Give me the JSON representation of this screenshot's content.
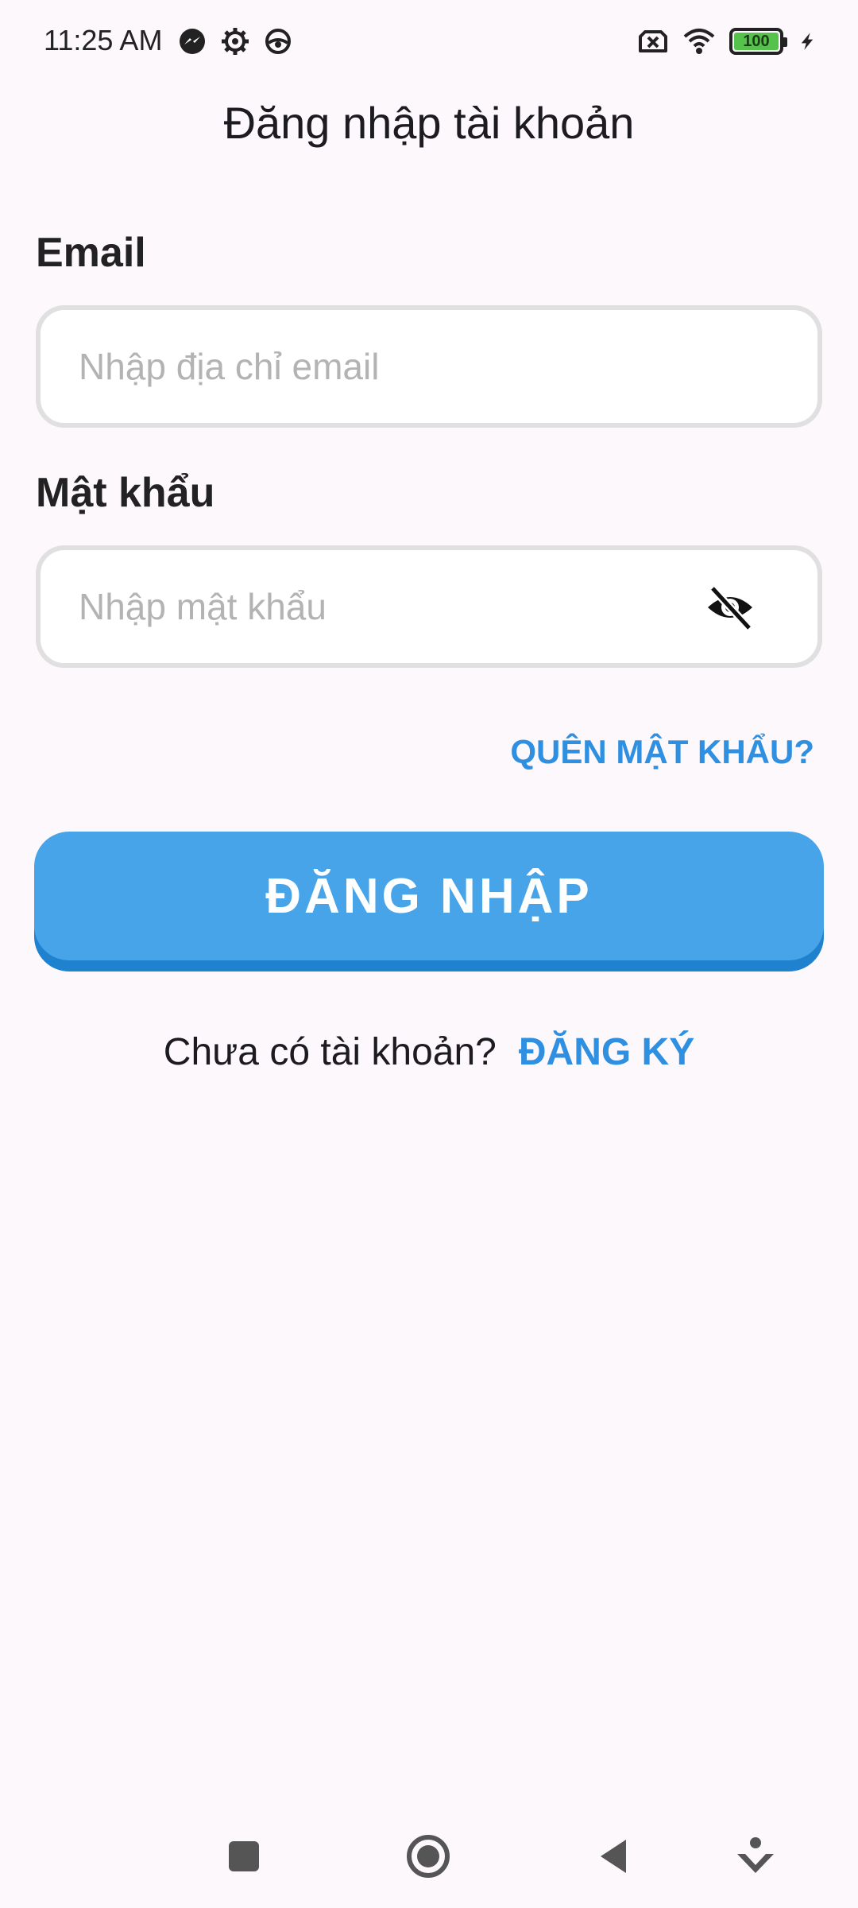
{
  "status_bar": {
    "time": "11:25 AM",
    "left_icons": [
      "messenger-icon",
      "gear-icon",
      "steering-wheel-icon"
    ],
    "right_icons": [
      "no-sim-icon",
      "wifi-icon",
      "battery-icon",
      "charging-icon"
    ],
    "battery_level": "100"
  },
  "page": {
    "title": "Đăng nhập tài khoản"
  },
  "form": {
    "email_label": "Email",
    "email_placeholder": "Nhập địa chỉ email",
    "email_value": "",
    "password_label": "Mật khẩu",
    "password_placeholder": "Nhập mật khẩu",
    "password_value": "",
    "password_toggle_icon": "eye-off-icon",
    "forgot_password": "QUÊN MẬT KHẨU?",
    "login_button": "ĐĂNG NHẬP"
  },
  "register": {
    "prompt": "Chưa có tài khoản?",
    "link": "ĐĂNG KÝ"
  },
  "nav_bar": {
    "buttons": [
      "recents-icon",
      "home-icon",
      "back-icon",
      "extra-icon"
    ]
  },
  "colors": {
    "background": "#fdf8fc",
    "accent": "#2f8fe0",
    "button": "#48a4e8",
    "button_shadow": "#1f82cf",
    "input_border": "#e0e0e0",
    "battery_fill": "#54c24b"
  }
}
